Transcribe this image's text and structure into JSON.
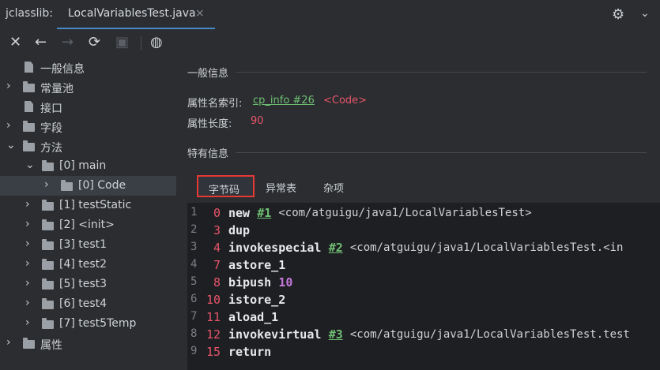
{
  "app": {
    "title": "jclasslib:",
    "tab_label": "LocalVariablesTest.java",
    "tab_close": "×"
  },
  "icons": {
    "gear": "gear-icon",
    "dropdown": "chevron-down-icon"
  },
  "toolbar": {
    "close": "✕",
    "back": "←",
    "forward": "→",
    "refresh": "⟳",
    "save": "▣",
    "web": "◍"
  },
  "tree": {
    "items": [
      {
        "label": "一般信息",
        "kind": "file",
        "indent": 0
      },
      {
        "label": "常量池",
        "kind": "folder",
        "indent": 0,
        "arrow": "›"
      },
      {
        "label": "接口",
        "kind": "file",
        "indent": 0
      },
      {
        "label": "字段",
        "kind": "folder",
        "indent": 0,
        "arrow": "›"
      },
      {
        "label": "方法",
        "kind": "folder",
        "indent": 0,
        "arrow": "⌄"
      },
      {
        "label": "[0] main",
        "kind": "folder",
        "indent": 1,
        "arrow": "⌄"
      },
      {
        "label": "[0] Code",
        "kind": "folder",
        "indent": 2,
        "arrow": "›",
        "selected": true
      },
      {
        "label": "[1] testStatic",
        "kind": "folder",
        "indent": 1,
        "arrow": "›"
      },
      {
        "label": "[2] <init>",
        "kind": "folder",
        "indent": 1,
        "arrow": "›"
      },
      {
        "label": "[3] test1",
        "kind": "folder",
        "indent": 1,
        "arrow": "›"
      },
      {
        "label": "[4] test2",
        "kind": "folder",
        "indent": 1,
        "arrow": "›"
      },
      {
        "label": "[5] test3",
        "kind": "folder",
        "indent": 1,
        "arrow": "›"
      },
      {
        "label": "[6] test4",
        "kind": "folder",
        "indent": 1,
        "arrow": "›"
      },
      {
        "label": "[7] test5Temp",
        "kind": "folder",
        "indent": 1,
        "arrow": "›"
      },
      {
        "label": "属性",
        "kind": "folder",
        "indent": 0,
        "arrow": "›"
      }
    ]
  },
  "general": {
    "heading": "一般信息",
    "name_index_label": "属性名索引:",
    "name_index_link": "cp_info #26",
    "name_index_value": "<Code>",
    "length_label": "属性长度:",
    "length_value": "90"
  },
  "specific": {
    "heading": "特有信息",
    "tabs": [
      "字节码",
      "异常表",
      "杂项"
    ]
  },
  "bytecode": [
    {
      "line": "1",
      "offset": "0",
      "op": "new",
      "arg": "#1",
      "argType": "ref",
      "comment": "<com/atguigu/java1/LocalVariablesTest>"
    },
    {
      "line": "2",
      "offset": "3",
      "op": "dup",
      "arg": "",
      "argType": "",
      "comment": ""
    },
    {
      "line": "3",
      "offset": "4",
      "op": "invokespecial",
      "arg": "#2",
      "argType": "ref",
      "comment": "<com/atguigu/java1/LocalVariablesTest.<in"
    },
    {
      "line": "4",
      "offset": "7",
      "op": "astore_1",
      "arg": "",
      "argType": "",
      "comment": ""
    },
    {
      "line": "5",
      "offset": "8",
      "op": "bipush",
      "arg": "10",
      "argType": "num",
      "comment": ""
    },
    {
      "line": "6",
      "offset": "10",
      "op": "istore_2",
      "arg": "",
      "argType": "",
      "comment": ""
    },
    {
      "line": "7",
      "offset": "11",
      "op": "aload_1",
      "arg": "",
      "argType": "",
      "comment": ""
    },
    {
      "line": "8",
      "offset": "12",
      "op": "invokevirtual",
      "arg": "#3",
      "argType": "ref",
      "comment": "<com/atguigu/java1/LocalVariablesTest.test"
    },
    {
      "line": "9",
      "offset": "15",
      "op": "return",
      "arg": "",
      "argType": "",
      "comment": ""
    }
  ]
}
